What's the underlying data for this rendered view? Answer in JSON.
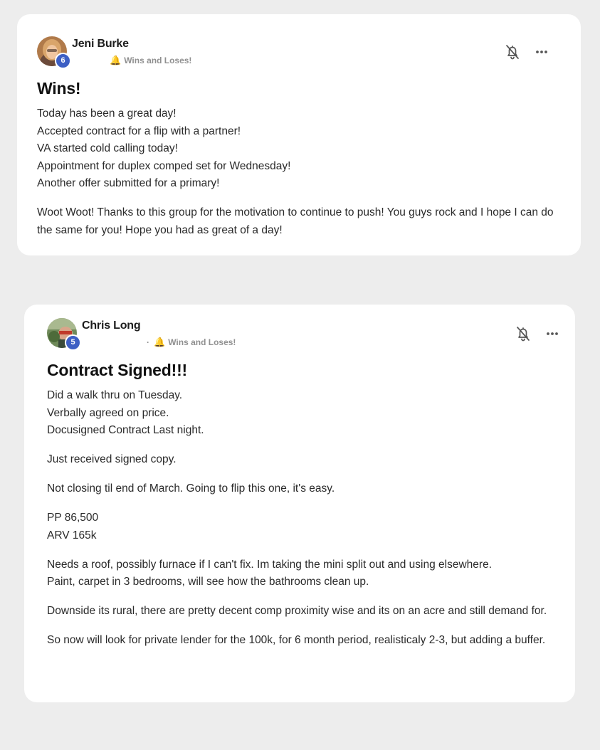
{
  "posts": [
    {
      "author": "Jeni Burke",
      "level": "6",
      "meta_dot": "",
      "category": "Wins and Loses!",
      "title": "Wins!",
      "paragraphs": [
        [
          "Today has been a great day!",
          "Accepted contract for a flip with a partner!",
          "VA started cold calling today!",
          "Appointment for duplex comped set for Wednesday!",
          "Another offer submitted for a primary!"
        ],
        [
          "Woot Woot! Thanks to this group for the motivation to continue to push! You guys rock and I hope I can do the same for you! Hope you had as great of a day!"
        ]
      ],
      "icons": {
        "bell": "bell-off-icon",
        "more": "more-horizontal-icon",
        "category": "bell-emoji-icon"
      }
    },
    {
      "author": "Chris Long",
      "level": "5",
      "meta_dot": "·",
      "category": "Wins and Loses!",
      "title": "Contract Signed!!!",
      "paragraphs": [
        [
          "Did a walk thru on Tuesday.",
          "Verbally agreed on price.",
          "Docusigned Contract Last night."
        ],
        [
          "Just received signed copy."
        ],
        [
          "Not closing til end of March. Going to flip this one, it's easy."
        ],
        [
          "PP 86,500",
          "ARV 165k"
        ],
        [
          "Needs a roof, possibly furnace if I can't fix. Im taking the mini split out and using elsewhere.",
          "Paint, carpet in 3 bedrooms, will see how the bathrooms clean up."
        ],
        [
          "Downside its rural, there are pretty decent comp proximity wise and its on an acre and still demand for."
        ],
        [
          "So now will look for private lender for the 100k, for 6 month period, realisticaly 2-3, but adding a buffer."
        ]
      ],
      "icons": {
        "bell": "bell-off-icon",
        "more": "more-horizontal-icon",
        "category": "bell-emoji-icon"
      }
    }
  ],
  "colors": {
    "page_bg": "#ededed",
    "card_bg": "#ffffff",
    "level_badge": "#3d5fc4",
    "bell_emoji": "#f2b705",
    "meta_text": "#909090"
  }
}
